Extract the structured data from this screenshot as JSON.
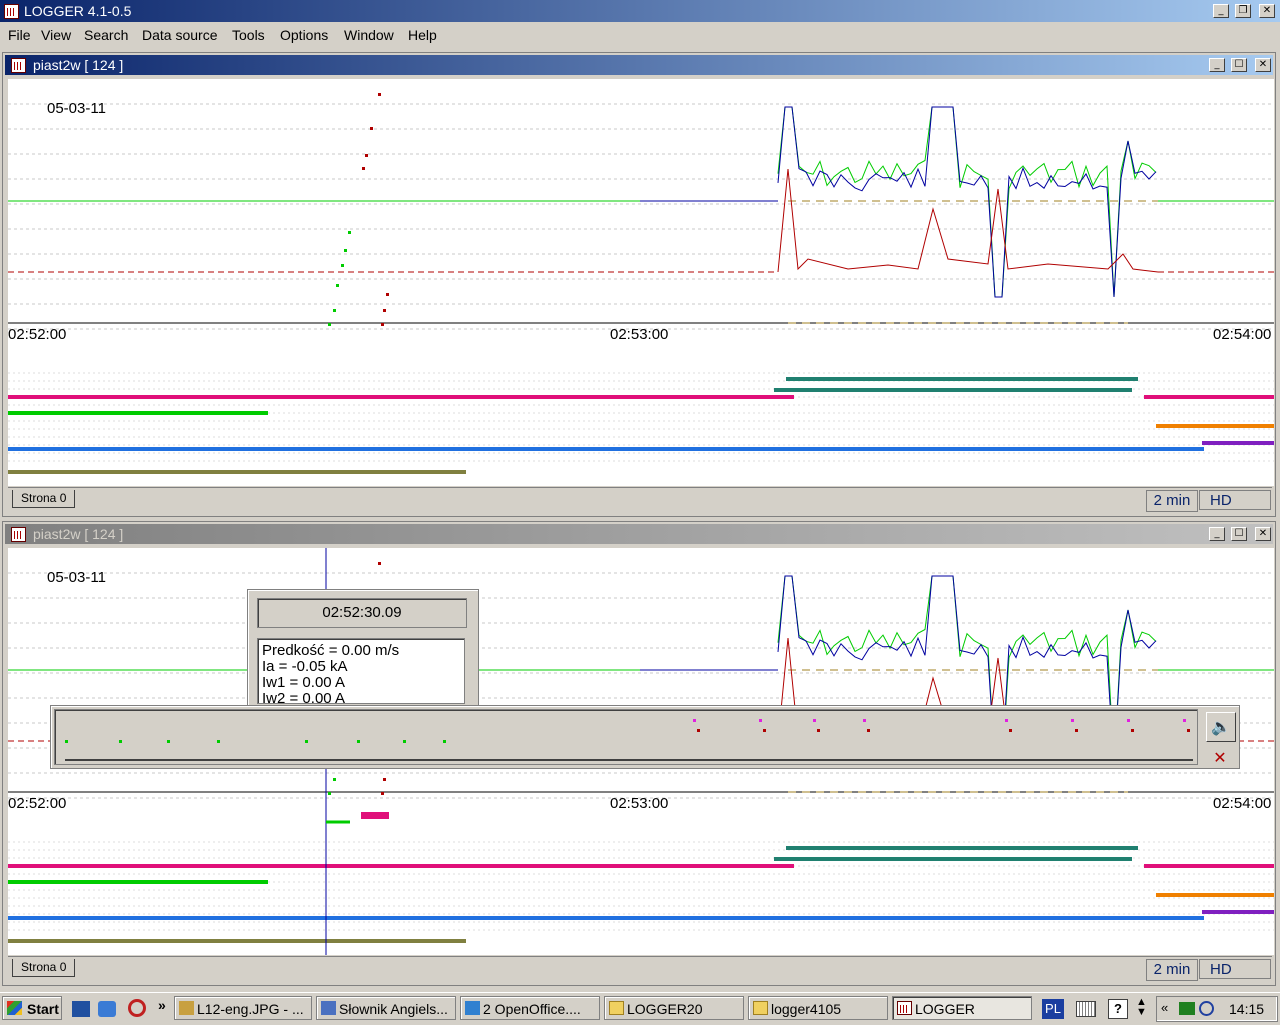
{
  "app": {
    "title": "LOGGER 4.1-0.5"
  },
  "menu": [
    "File",
    "View",
    "Search",
    "Data source",
    "Tools",
    "Options",
    "Window",
    "Help"
  ],
  "colors": {
    "active_title": "#0a246a",
    "plot_bg": "#ffffff",
    "green": "#00cc00",
    "red": "#b00000",
    "blue": "#0000a0",
    "magenta": "#e0107a",
    "teal": "#208070",
    "orange": "#f08000",
    "purple": "#8020c0",
    "olive": "#808040",
    "lightblue": "#2070e0"
  },
  "windows": [
    {
      "title": "piast2w    [ 124 ]",
      "date": "05-03-11",
      "times": [
        "02:52:00",
        "02:53:00",
        "02:54:00"
      ],
      "tab": "Strona 0",
      "range": "2 min",
      "mode": "HD"
    },
    {
      "title": "piast2w    [ 124 ]",
      "date": "05-03-11",
      "times": [
        "02:52:00",
        "02:53:00",
        "02:54:00"
      ],
      "tab": "Strona 0",
      "range": "2 min",
      "mode": "HD"
    }
  ],
  "cursor_info": {
    "time": "02:52:30.09",
    "lines": [
      "Predkość =   0.00 m/s",
      "Ia =  -0.05 kA",
      "Iw1 =   0.00 A",
      "Iw2 =   0.00 A"
    ]
  },
  "taskbar": {
    "start": "Start",
    "items": [
      "L12-eng.JPG - ...",
      "Słownik Angiels...",
      "2 OpenOffice....",
      "LOGGER20",
      "logger4105",
      "LOGGER"
    ],
    "lang": "PL",
    "clock": "14:15"
  }
}
